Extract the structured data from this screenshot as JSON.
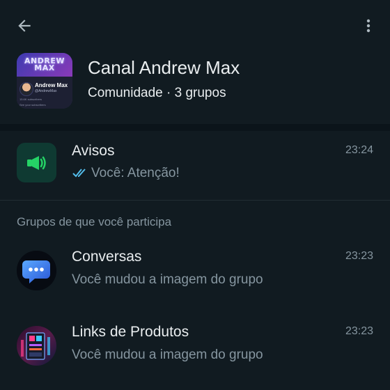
{
  "header": {
    "title": "Canal Andrew Max",
    "subtitle": "Comunidade · 3 grupos",
    "avatar": {
      "banner_text": "ANDREW MAX",
      "name": "Andrew Max",
      "handle": "@AndrewMax",
      "subscribers": "15.6K subscribers",
      "footer": "See your subscribers"
    }
  },
  "announcements": {
    "title": "Avisos",
    "time": "23:24",
    "preview": "Você: Atenção!"
  },
  "section": {
    "label": "Grupos de que você participa"
  },
  "groups": [
    {
      "title": "Conversas",
      "time": "23:23",
      "preview": "Você mudou a imagem do grupo"
    },
    {
      "title": "Links de Produtos",
      "time": "23:23",
      "preview": "Você mudou a imagem do grupo"
    }
  ],
  "colors": {
    "background": "#111b21",
    "accent": "#53bdeb",
    "text_primary": "#e9edef",
    "text_secondary": "#8696a0",
    "announce_bg": "#0f3a32",
    "announce_icon": "#25d366"
  }
}
